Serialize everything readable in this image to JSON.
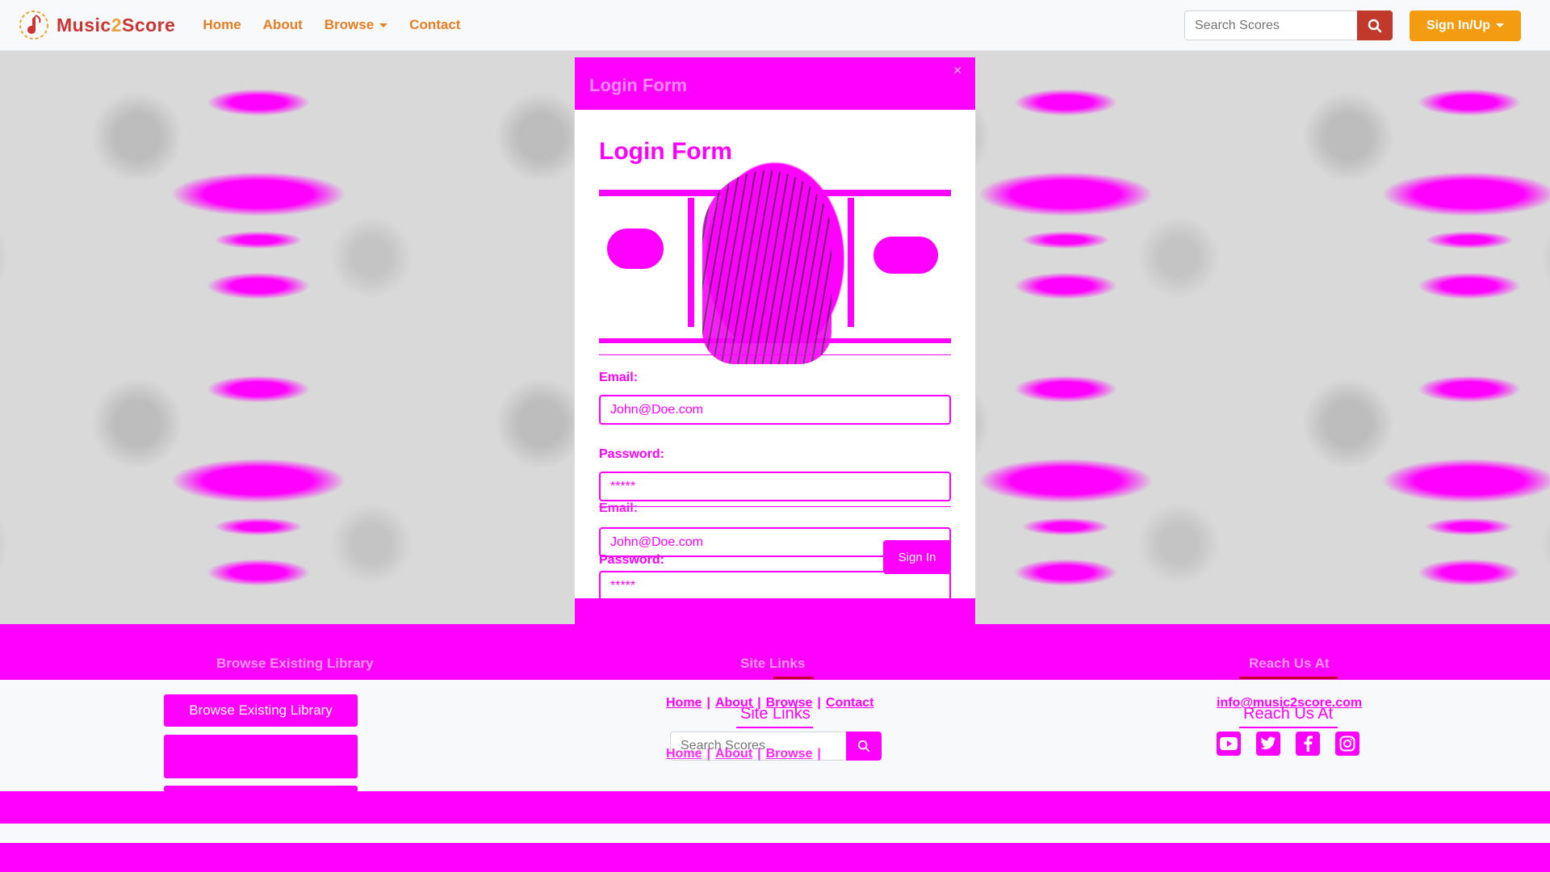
{
  "navbar": {
    "brand": "Music",
    "brand_two": "2",
    "brand_score": "Score",
    "links": {
      "home": "Home",
      "about": "About",
      "browse": "Browse",
      "contact": "Contact"
    },
    "search_placeholder": "Search Scores",
    "signin_label": "Sign In/Up"
  },
  "modal": {
    "form_title": "Login Form",
    "email_label": "Email:",
    "email_value": "John@Doe.com",
    "password_label": "Password:",
    "password_value": "*****",
    "submit_label": "Sign In"
  },
  "footer": {
    "library_button": "Browse Existing Library",
    "site_links_title": "Site Links",
    "links": {
      "home": "Home",
      "about": "About",
      "browse": "Browse",
      "contact": "Contact"
    },
    "separator": "|",
    "search_placeholder": "Search Scores",
    "reach_title": "Reach Us At",
    "email": "info@music2score.com"
  },
  "colors": {
    "brand_red": "#cc3333",
    "nav_orange": "#e67e22",
    "signin_orange": "#f39c12",
    "search_red": "#c0392b",
    "overlay_magenta": "#ff00ff"
  },
  "icons": [
    "music-note-logo-icon",
    "search-icon",
    "caret-down-icon",
    "youtube-icon",
    "twitter-icon",
    "facebook-icon",
    "instagram-icon"
  ]
}
